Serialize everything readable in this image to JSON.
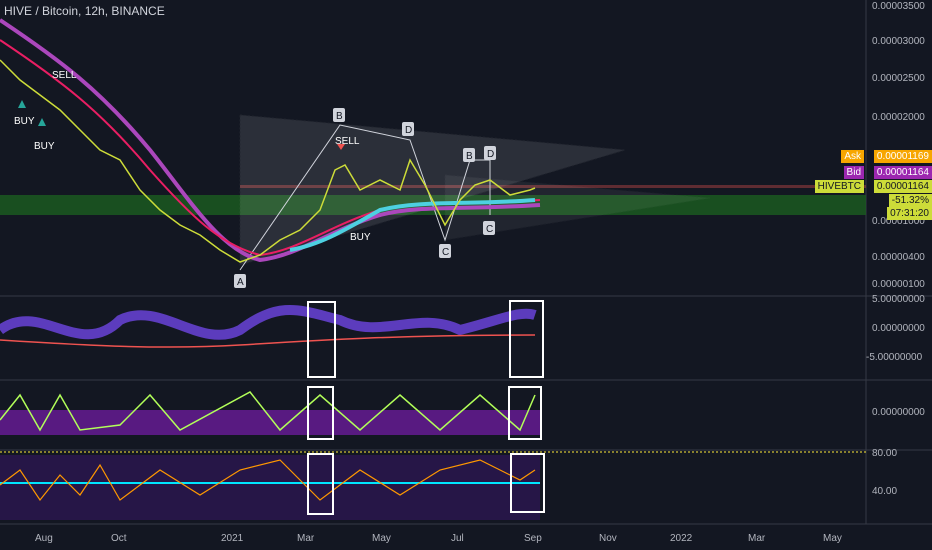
{
  "header": {
    "title": "HIVE / Bitcoin, 12h, BINANCE"
  },
  "price_axis": {
    "ticks": [
      "0.00003500",
      "0.00003000",
      "0.00002500",
      "0.00002000",
      "0.00001000",
      "0.00000400",
      "0.00000100"
    ],
    "ask_label": "Ask",
    "ask_value": "0.00001169",
    "bid_label": "Bid",
    "bid_value": "0.00001164",
    "symbol_label": "HIVEBTC",
    "last_value": "0.00001164",
    "change": "-51.32%",
    "countdown": "07:31:20"
  },
  "osc1_axis": {
    "ticks": [
      "5.00000000",
      "0.00000000",
      "-5.00000000"
    ]
  },
  "osc2_axis": {
    "ticks": [
      "0.00000000"
    ]
  },
  "osc3_axis": {
    "ticks": [
      "80.00",
      "40.00"
    ]
  },
  "time_axis": {
    "labels": [
      "Aug",
      "Oct",
      "2021",
      "Mar",
      "May",
      "Jul",
      "Sep",
      "Nov",
      "2022",
      "Mar",
      "May"
    ]
  },
  "annotations": {
    "sell_1": "SELL",
    "buy_1": "BUY",
    "buy_2": "BUY",
    "sell_2": "SELL",
    "buy_3": "BUY",
    "pt_a": "A",
    "pt_b1": "B",
    "pt_d1": "D",
    "pt_c1": "C",
    "pt_b2": "B",
    "pt_d2": "D",
    "pt_c2": "C"
  },
  "colors": {
    "bg": "#131722",
    "ask": "#f7a600",
    "bid": "#9c27b0",
    "last": "#cddc39",
    "sell_marker": "#ef5350",
    "buy_marker": "#26a69a"
  }
}
